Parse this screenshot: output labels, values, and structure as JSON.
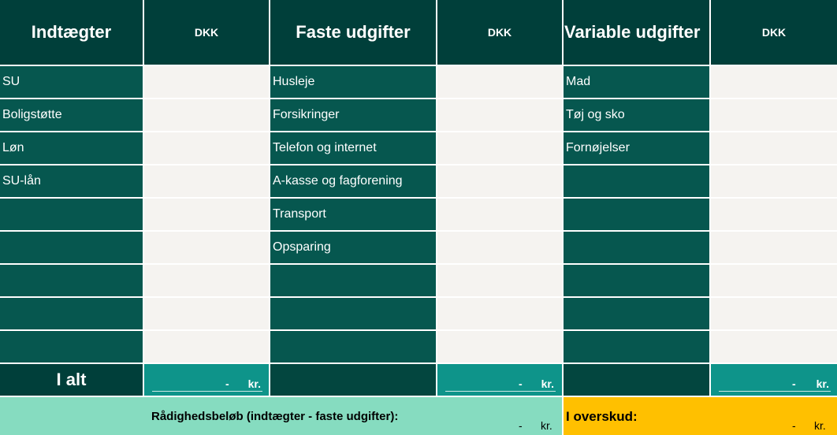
{
  "headers": {
    "income": "Indtægter",
    "fixed": "Faste udgifter",
    "variable": "Variable udgifter",
    "currency": "DKK"
  },
  "income_rows": [
    "SU",
    "Boligstøtte",
    "Løn",
    "SU-lån",
    "",
    "",
    "",
    "",
    ""
  ],
  "fixed_rows": [
    "Husleje",
    "Forsikringer",
    "Telefon og internet",
    "A-kasse og fagforening",
    "Transport",
    "Opsparing",
    "",
    "",
    ""
  ],
  "variable_rows": [
    "Mad",
    "Tøj og sko",
    "Fornøjelser",
    "",
    "",
    "",
    "",
    "",
    ""
  ],
  "totals": {
    "label": "I alt",
    "dash": "-",
    "unit": "kr."
  },
  "summary": {
    "label": "Rådighedsbeløb (indtægter - faste udgifter):",
    "dash": "-",
    "unit": "kr.",
    "surplus_label": "I overskud:",
    "surplus_dash": "-",
    "surplus_unit": "kr."
  },
  "colors": {
    "header_bg": "#003f3a",
    "label_bg": "#06574f",
    "input_bg": "#f5f3f0",
    "total_bg": "#0e948a",
    "summary_bg": "#86dcc0",
    "surplus_bg": "#ffc000"
  }
}
